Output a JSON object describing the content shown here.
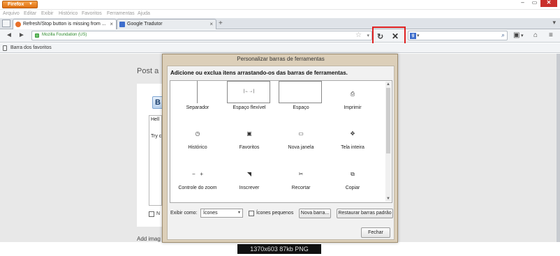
{
  "window": {
    "app_button": "Firefox",
    "controls": {
      "minimize": "–",
      "restore": "▭",
      "close": "✕"
    }
  },
  "menubar": {
    "items": [
      "Arquivo",
      "Editar",
      "Exibir",
      "Histórico",
      "Favoritos",
      "Ferramentas",
      "Ajuda"
    ]
  },
  "tabs": [
    {
      "label": "Refresh/Stop button is missing from ...",
      "close": "×",
      "favicon_color": "#e8702a"
    },
    {
      "label": "Google Tradutor",
      "close": "×",
      "favicon_color": "#3d6dcc"
    }
  ],
  "tabbar": {
    "new_tab": "+",
    "list_tabs": "▾"
  },
  "navbar": {
    "back": "◄",
    "forward": "►",
    "identity": "Mozilla Foundation (US)",
    "url_value": "",
    "bookmark_star": "☆",
    "url_dropdown": "▾",
    "reload": "↻",
    "stop": "✕",
    "search_engine": "g",
    "search_engine_caret": "▾",
    "search_value": "",
    "search_go": "⌕",
    "toolbar_icons": [
      "▣",
      "▾",
      "⌂",
      "≡"
    ]
  },
  "bookmarks_toolbar": {
    "label": "Barra dos favoritos"
  },
  "page": {
    "post_title": "Post a",
    "bold_button": "B",
    "editor_lines": [
      "Hell",
      "Try c"
    ],
    "checkbox_label": "N",
    "add_image": "Add imag"
  },
  "dialog": {
    "title": "Personalizar barras de ferramentas",
    "instruction": "Adicione ou exclua itens arrastando-os das barras de ferramentas.",
    "palette_items": [
      {
        "label": "Separador",
        "icon": "separator"
      },
      {
        "label": "Espaço flexível",
        "icon": "flexible-space",
        "glyph": "|←→|"
      },
      {
        "label": "Espaço",
        "icon": "space"
      },
      {
        "label": "Imprimir",
        "icon": "print-icon",
        "glyph": "⎙"
      },
      {
        "label": "Histórico",
        "icon": "history-icon",
        "glyph": "◷"
      },
      {
        "label": "Favoritos",
        "icon": "bookmarks-icon",
        "glyph": "▣"
      },
      {
        "label": "Nova janela",
        "icon": "new-window-icon",
        "glyph": "▭"
      },
      {
        "label": "Tela inteira",
        "icon": "fullscreen-icon",
        "glyph": "✥"
      },
      {
        "label": "Controle do zoom",
        "icon": "zoom-icon",
        "glyph": "−   +"
      },
      {
        "label": "Inscrever",
        "icon": "rss-icon",
        "glyph": "◥"
      },
      {
        "label": "Recortar",
        "icon": "cut-icon",
        "glyph": "✂"
      },
      {
        "label": "Copiar",
        "icon": "copy-icon",
        "glyph": "⧉"
      }
    ],
    "show_as_label": "Exibir como:",
    "show_as_value": "Ícones",
    "show_as_caret": "▾",
    "small_icons_label": "Ícones pequenos",
    "small_icons_checked": false,
    "new_toolbar_button": "Nova barra...",
    "restore_default_button": "Restaurar barras padrão",
    "close_button": "Fechar",
    "scroll_up": "▲",
    "scroll_down": "▼"
  },
  "watermark": "1370x603  87kb  PNG",
  "colors": {
    "firefox_orange": "#e8702a",
    "dialog_frame": "#dccfb9",
    "highlight_red": "#e02020"
  }
}
